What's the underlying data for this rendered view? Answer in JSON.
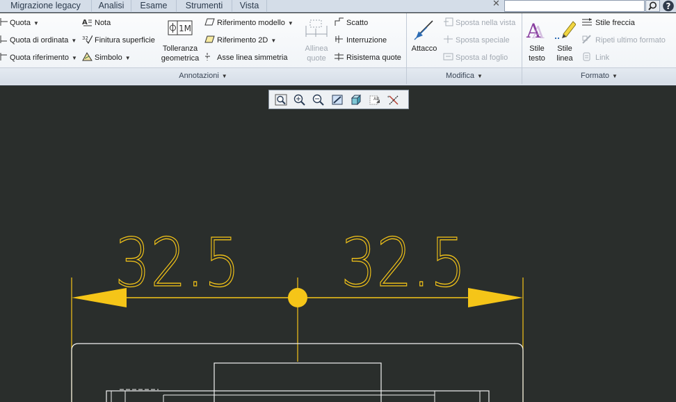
{
  "tabs": [
    "Migrazione legacy",
    "Analisi",
    "Esame",
    "Strumenti",
    "Vista"
  ],
  "ribbon": {
    "annotazioni": {
      "footer": "Annotazioni",
      "quota": "Quota",
      "quota_ordinata": "Quota di ordinata",
      "quota_riferimento": "Quota riferimento",
      "nota": "Nota",
      "finitura": "Finitura superficie",
      "simbolo": "Simbolo",
      "tolleranza_line1": "Tolleranza",
      "tolleranza_line2": "geometrica",
      "rif_modello": "Riferimento modello",
      "rif_2d": "Riferimento 2D",
      "asse": "Asse linea simmetria",
      "allinea_line1": "Allinea",
      "allinea_line2": "quote",
      "scatto": "Scatto",
      "interruzione": "Interruzione",
      "risistema": "Risistema quote"
    },
    "modifica": {
      "footer": "Modifica",
      "attacco": "Attacco",
      "sposta_vista": "Sposta nella vista",
      "sposta_speciale": "Sposta speciale",
      "sposta_foglio": "Sposta al foglio"
    },
    "formato": {
      "footer": "Formato",
      "stile_testo_line1": "Stile",
      "stile_testo_line2": "testo",
      "stile_linea_line1": "Stile",
      "stile_linea_line2": "linea",
      "stile_freccia": "Stile freccia",
      "ripeti": "Ripeti ultimo formato",
      "link": "Link"
    }
  },
  "drawing": {
    "dim_left": "32.5",
    "dim_right": "32.5",
    "line_color": "#f5c518",
    "geometry_color": "#ffffff"
  },
  "view_toolbar": [
    "zoom-fit-icon",
    "zoom-in-icon",
    "zoom-out-icon",
    "repaint-icon",
    "display-style-icon",
    "annotation-display-icon",
    "datum-display-icon"
  ]
}
